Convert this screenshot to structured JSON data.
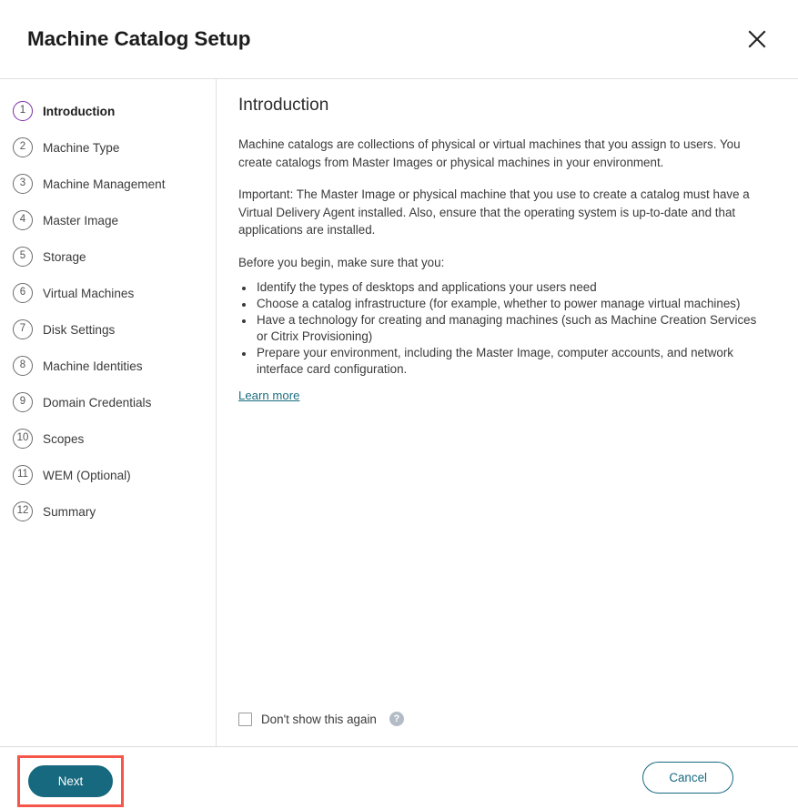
{
  "header": {
    "title": "Machine Catalog Setup",
    "close_icon": "close-icon"
  },
  "sidebar": {
    "steps": [
      {
        "number": "1",
        "label": "Introduction",
        "active": true
      },
      {
        "number": "2",
        "label": "Machine Type",
        "active": false
      },
      {
        "number": "3",
        "label": "Machine Management",
        "active": false
      },
      {
        "number": "4",
        "label": "Master Image",
        "active": false
      },
      {
        "number": "5",
        "label": "Storage",
        "active": false
      },
      {
        "number": "6",
        "label": "Virtual Machines",
        "active": false
      },
      {
        "number": "7",
        "label": "Disk Settings",
        "active": false
      },
      {
        "number": "8",
        "label": "Machine Identities",
        "active": false
      },
      {
        "number": "9",
        "label": "Domain Credentials",
        "active": false
      },
      {
        "number": "10",
        "label": "Scopes",
        "active": false
      },
      {
        "number": "11",
        "label": "WEM (Optional)",
        "active": false
      },
      {
        "number": "12",
        "label": "Summary",
        "active": false
      }
    ]
  },
  "content": {
    "title": "Introduction",
    "paragraph1": "Machine catalogs are collections of physical or virtual machines that you assign to users. You create catalogs from Master Images or physical machines in your environment.",
    "paragraph2": "Important: The Master Image or physical machine that you use to create a catalog must have a Virtual Delivery Agent installed. Also, ensure that the operating system is up-to-date and that applications are installed.",
    "list_intro": "Before you begin, make sure that you:",
    "bullets": [
      "Identify the types of desktops and applications your users need",
      "Choose a catalog infrastructure (for example, whether to power manage virtual machines)",
      "Have a technology for creating and managing machines (such as Machine Creation Services or Citrix Provisioning)",
      "Prepare your environment, including the Master Image, computer accounts, and network interface card configuration."
    ],
    "learn_more": "Learn more",
    "dont_show_label": "Don't show this again",
    "dont_show_checked": false,
    "help_icon_glyph": "?"
  },
  "footer": {
    "next_label": "Next",
    "cancel_label": "Cancel"
  },
  "colors": {
    "accent_teal": "#16697f",
    "active_step_purple": "#7d2fa8",
    "highlight_red": "#f4564a",
    "link_teal": "#1b6d80",
    "help_grey": "#b3bcc6"
  }
}
